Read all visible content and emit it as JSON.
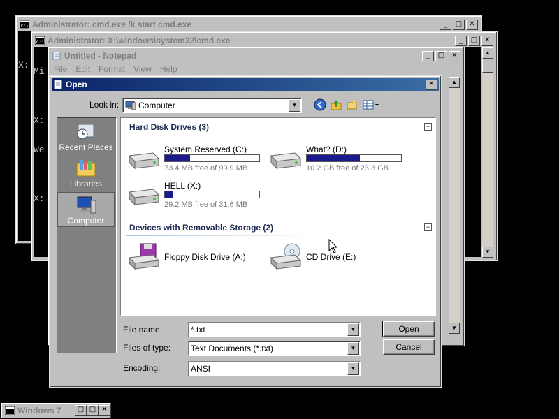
{
  "cmd1": {
    "title": "Administrator: cmd.exe /k start cmd.exe",
    "lines": [
      "X:"
    ]
  },
  "cmd2": {
    "title": "Administrator: X:\\windows\\system32\\cmd.exe",
    "lines": [
      "Mi",
      "",
      "X:",
      "We",
      "",
      "X:"
    ]
  },
  "notepad": {
    "title": "Untitled - Notepad",
    "menu": [
      "File",
      "Edit",
      "Format",
      "View",
      "Help"
    ]
  },
  "caption_buttons": {
    "minimize": "_",
    "maximize": "□",
    "close": "✕"
  },
  "open_dialog": {
    "title": "Open",
    "look_in_label": "Look in:",
    "look_in_value": "Computer",
    "toolbar_icons": [
      "back-icon",
      "up-folder-icon",
      "new-folder-icon",
      "views-menu-icon"
    ],
    "places": [
      {
        "label": "Recent Places",
        "icon": "recent-places-icon"
      },
      {
        "label": "Libraries",
        "icon": "libraries-icon"
      },
      {
        "label": "Computer",
        "icon": "computer-icon",
        "selected": true
      }
    ],
    "groups": [
      {
        "header": "Hard Disk Drives (3)",
        "drives": [
          {
            "name": "System Reserved (C:)",
            "free": "73.4 MB free of 99.9 MB",
            "used_fraction": 0.27
          },
          {
            "name": "What? (D:)",
            "free": "10.2 GB free of 23.3 GB",
            "used_fraction": 0.56
          },
          {
            "name": "HELL (X:)",
            "free": "29.2 MB free of 31.6 MB",
            "used_fraction": 0.08
          }
        ]
      },
      {
        "header": "Devices with Removable Storage (2)",
        "drives": [
          {
            "name": "Floppy Disk Drive (A:)"
          },
          {
            "name": "CD Drive (E:)"
          }
        ]
      }
    ],
    "file_name_label": "File name:",
    "file_name_value": "*.txt",
    "file_type_label": "Files of type:",
    "file_type_value": "Text Documents (*.txt)",
    "encoding_label": "Encoding:",
    "encoding_value": "ANSI",
    "open_button": "Open",
    "cancel_button": "Cancel"
  },
  "taskbar": {
    "label": "Windows 7"
  }
}
